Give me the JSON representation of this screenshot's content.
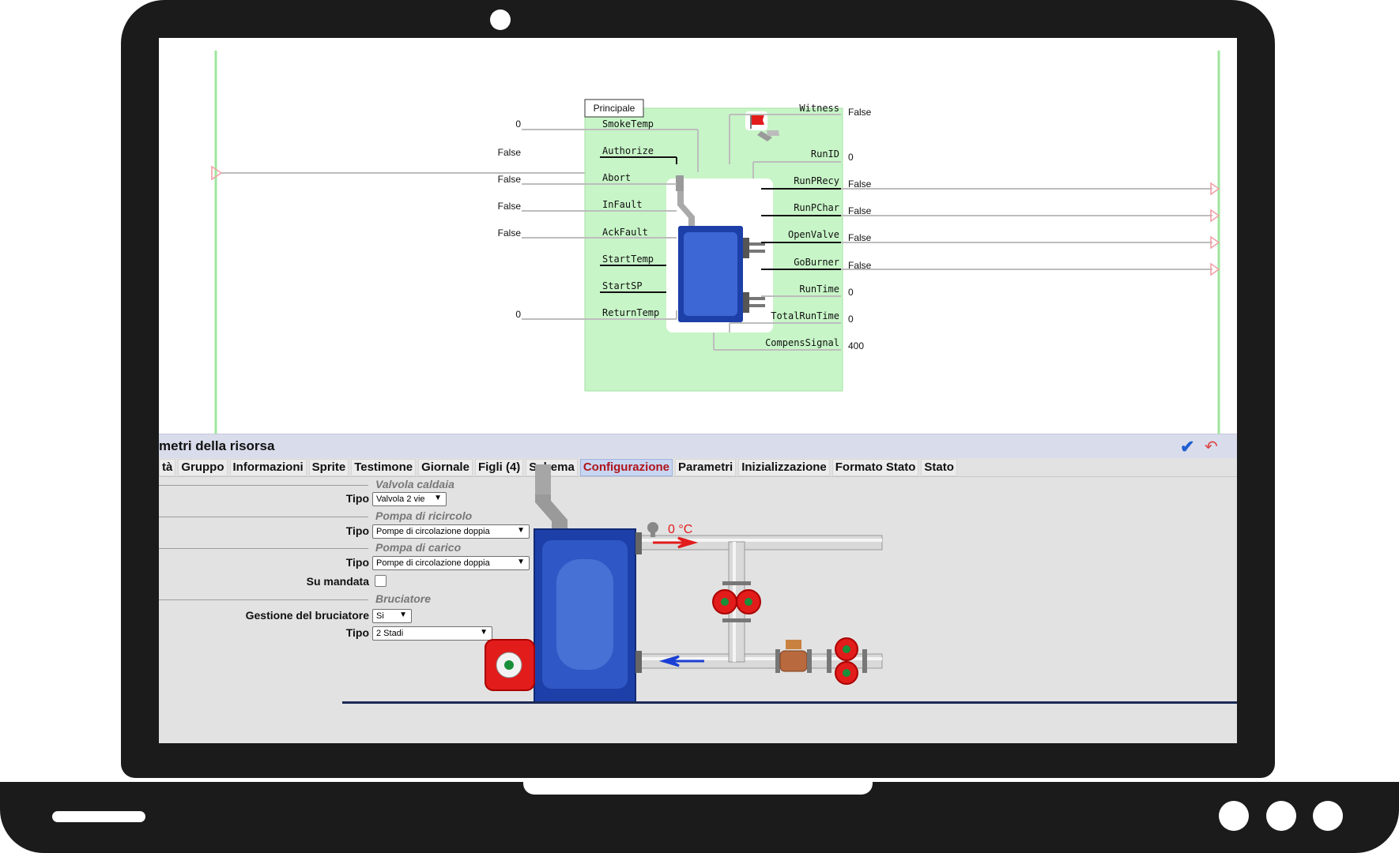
{
  "diagram": {
    "block_label": "Principale",
    "inputs": [
      {
        "name": "SmokeTemp",
        "value": "0"
      },
      {
        "name": "Authorize",
        "value": "False"
      },
      {
        "name": "Abort",
        "value": "False"
      },
      {
        "name": "InFault",
        "value": "False"
      },
      {
        "name": "AckFault",
        "value": "False"
      },
      {
        "name": "StartTemp",
        "value": ""
      },
      {
        "name": "StartSP",
        "value": ""
      },
      {
        "name": "ReturnTemp",
        "value": "0"
      }
    ],
    "outputs": [
      {
        "name": "Witness",
        "value": "False"
      },
      {
        "name": "RunID",
        "value": "0"
      },
      {
        "name": "RunPRecy",
        "value": "False"
      },
      {
        "name": "RunPChar",
        "value": "False"
      },
      {
        "name": "OpenValve",
        "value": "False"
      },
      {
        "name": "GoBurner",
        "value": "False"
      },
      {
        "name": "RunTime",
        "value": "0"
      },
      {
        "name": "TotalRunTime",
        "value": "0"
      },
      {
        "name": "CompensSignal",
        "value": "400"
      }
    ]
  },
  "panel": {
    "title": "metri della risorsa",
    "tabs": [
      "tà",
      "Gruppo",
      "Informazioni",
      "Sprite",
      "Testimone",
      "Giornale",
      "Figli (4)",
      "Schema",
      "Configurazione",
      "Parametri",
      "Inizializzazione",
      "Formato Stato",
      "Stato"
    ],
    "active_tab": "Configurazione",
    "sections": {
      "valvola": {
        "title": "Valvola caldaia",
        "tipo_label": "Tipo",
        "tipo_value": "Valvola 2 vie"
      },
      "ricircolo": {
        "title": "Pompa di ricircolo",
        "tipo_label": "Tipo",
        "tipo_value": "Pompe di circolazione doppia"
      },
      "carico": {
        "title": "Pompa di carico",
        "tipo_label": "Tipo",
        "tipo_value": "Pompe di circolazione doppia",
        "mandata_label": "Su mandata",
        "mandata_checked": false
      },
      "bruciatore": {
        "title": "Bruciatore",
        "gestione_label": "Gestione del bruciatore",
        "gestione_value": "Si",
        "tipo_label": "Tipo",
        "tipo_value": "2 Stadi"
      }
    }
  },
  "schematic": {
    "temperature": "0 °C"
  },
  "colors": {
    "block_bg": "#c7f5c7",
    "bus_line": "#9ee79e",
    "boiler_blue": "#1d3fa8",
    "active_tab": "#b0141b",
    "pump_red": "#e21b1b"
  }
}
